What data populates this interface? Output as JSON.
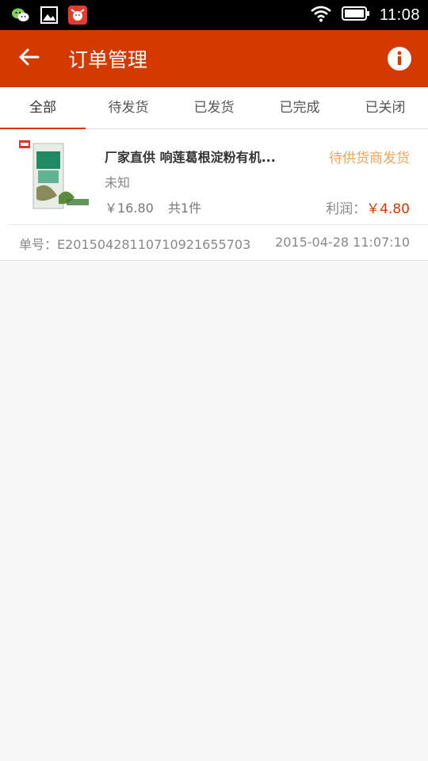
{
  "status_bar": {
    "time": "11:08",
    "icons": [
      "wechat-icon",
      "gallery-icon",
      "app-icon",
      "wifi-icon",
      "battery-icon"
    ]
  },
  "app_bar": {
    "title": "订单管理",
    "back_icon": "arrow-left-icon",
    "info_icon": "info-icon",
    "color": "#d43a00"
  },
  "tabs": [
    {
      "label": "全部",
      "active": true
    },
    {
      "label": "待发货",
      "active": false
    },
    {
      "label": "已发货",
      "active": false
    },
    {
      "label": "已完成",
      "active": false
    },
    {
      "label": "已关闭",
      "active": false
    }
  ],
  "orders": [
    {
      "product_title": "厂家直供 响莲葛根淀粉有机...",
      "status": "待供货商发货",
      "spec": "未知",
      "price": "￥16.80",
      "quantity": "共1件",
      "profit_label": "利润：",
      "profit_value": "￥4.80",
      "order_no": "单号：E20150428110710921655703",
      "order_time": "2015-04-28 11:07:10"
    }
  ],
  "colors": {
    "accent": "#d43a00",
    "status_pending": "#f3a45a",
    "background": "#f7f7f7"
  }
}
